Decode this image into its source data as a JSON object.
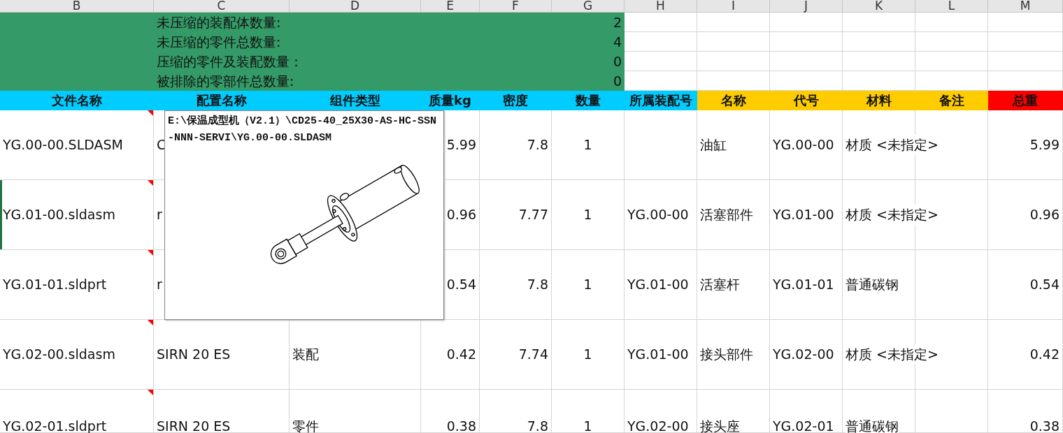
{
  "column_letters": [
    "B",
    "C",
    "D",
    "E",
    "F",
    "G",
    "H",
    "I",
    "J",
    "K",
    "L",
    "M"
  ],
  "summary": [
    {
      "label": "未压缩的装配体数量:",
      "value": "2"
    },
    {
      "label": "未压缩的零件总数量:",
      "value": "4"
    },
    {
      "label": "压缩的零件及装配数量：",
      "value": "0"
    },
    {
      "label": "被排除的零部件总数量:",
      "value": "0"
    }
  ],
  "table": {
    "columns": [
      {
        "label": "文件名称",
        "color": "#00ccff"
      },
      {
        "label": "配置名称",
        "color": "#00ccff"
      },
      {
        "label": "组件类型",
        "color": "#00ccff"
      },
      {
        "label": "质量kg",
        "color": "#00ccff"
      },
      {
        "label": "密度",
        "color": "#00ccff"
      },
      {
        "label": "数量",
        "color": "#00ccff"
      },
      {
        "label": "所属装配号",
        "color": "#00ccff"
      },
      {
        "label": "名称",
        "color": "#ffcc00"
      },
      {
        "label": "代号",
        "color": "#ffcc00"
      },
      {
        "label": "材料",
        "color": "#ffcc00"
      },
      {
        "label": "备注",
        "color": "#ffcc00"
      },
      {
        "label": "总重",
        "color": "#ff0000"
      }
    ],
    "rows": [
      {
        "selected": false,
        "has_comment": true,
        "file": "YG.00-00.SLDASM",
        "config": "C",
        "mass": "5.99",
        "density": "7.8",
        "quantity": "1",
        "name": "油缸",
        "code": "YG.00-00",
        "material": "材质 <未指定>",
        "total": "5.99"
      },
      {
        "selected": true,
        "has_comment": true,
        "file": "YG.01-00.sldasm",
        "config": "r",
        "mass": "0.96",
        "density": "7.77",
        "quantity": "1",
        "parent": "YG.00-00",
        "name": "活塞部件",
        "code": "YG.01-00",
        "material": "材质 <未指定>",
        "total": "0.96"
      },
      {
        "selected": false,
        "has_comment": true,
        "file": "YG.01-01.sldprt",
        "config": "r",
        "mass": "0.54",
        "density": "7.8",
        "quantity": "1",
        "parent": "YG.01-00",
        "name": "活塞杆",
        "code": "YG.01-01",
        "material": "普通碳钢",
        "total": "0.54"
      },
      {
        "selected": false,
        "has_comment": true,
        "file": "YG.02-00.sldasm",
        "config": "SIRN 20 ES",
        "type": "装配",
        "mass": "0.42",
        "density": "7.74",
        "quantity": "1",
        "parent": "YG.01-00",
        "name": "接头部件",
        "code": "YG.02-00",
        "material": "材质 <未指定>",
        "total": "0.42"
      },
      {
        "selected": false,
        "has_comment": true,
        "file": "YG.02-01.sldprt",
        "config": "SIRN 20 ES",
        "type": "零件",
        "mass": "0.38",
        "density": "7.8",
        "quantity": "1",
        "parent": "YG.02-00",
        "name": "接头座",
        "code": "YG.02-01",
        "material": "普通碳钢",
        "total": "0.38"
      }
    ]
  },
  "comment": {
    "text": "E:\\保温成型机（V2.1）\\CD25-40_25X30-AS-HC-SSN-NNN-SERVI\\YG.00-00.SLDASM"
  }
}
